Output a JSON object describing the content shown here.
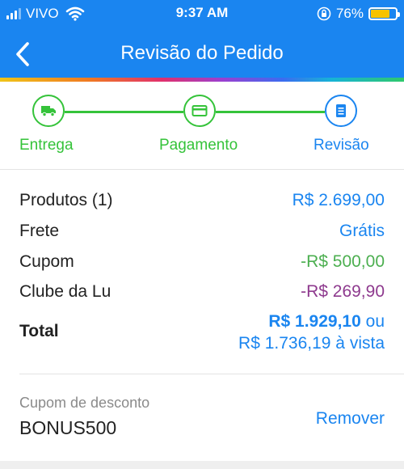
{
  "status_bar": {
    "carrier": "VIVO",
    "time": "9:37 AM",
    "battery_percent": "76%",
    "battery_level": 0.76,
    "icons": [
      "signal-icon",
      "wifi-icon",
      "orientation-lock-icon",
      "battery-icon"
    ]
  },
  "header": {
    "title": "Revisão do Pedido",
    "back_icon": "chevron-left-icon",
    "color": "#1a85f0"
  },
  "stepper": {
    "steps": [
      {
        "label": "Entrega",
        "icon": "truck-icon",
        "state": "done"
      },
      {
        "label": "Pagamento",
        "icon": "credit-card-icon",
        "state": "done"
      },
      {
        "label": "Revisão",
        "icon": "document-icon",
        "state": "active"
      }
    ],
    "done_color": "#35c33a",
    "active_color": "#1a85f0"
  },
  "summary": {
    "rows": [
      {
        "label": "Produtos (1)",
        "value": "R$ 2.699,00",
        "color": "#1a85f0"
      },
      {
        "label": "Frete",
        "value": "Grátis",
        "color": "#1a85f0"
      },
      {
        "label": "Cupom",
        "value": "-R$ 500,00",
        "color": "#4caf50"
      },
      {
        "label": "Clube da Lu",
        "value": "-R$ 269,90",
        "color": "#8e3a8e"
      }
    ],
    "total": {
      "label": "Total",
      "price": "R$ 1.929,10",
      "or": "ou",
      "cash_line": "R$ 1.736,19 à vista"
    }
  },
  "coupon": {
    "label": "Cupom de desconto",
    "code": "BONUS500",
    "remove_label": "Remover"
  }
}
